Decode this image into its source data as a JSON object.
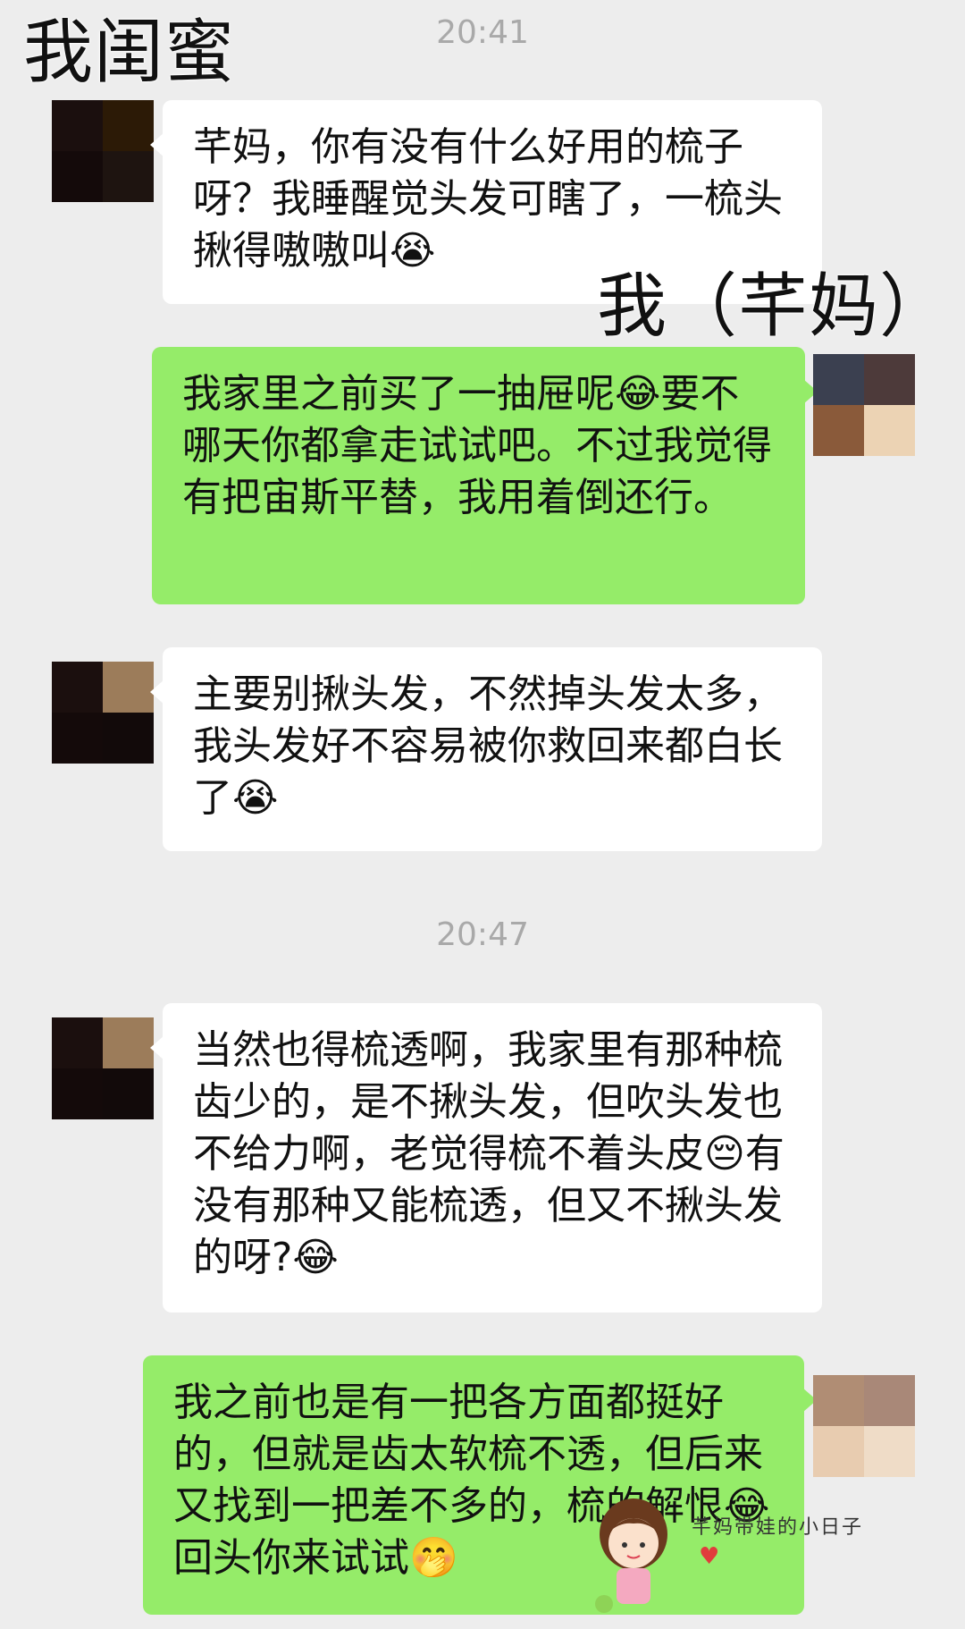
{
  "labels": {
    "friend": "我闺蜜",
    "me": "我（芊妈）"
  },
  "timestamps": [
    "20:41",
    "20:47"
  ],
  "messages": [
    {
      "side": "in",
      "text": "芊妈，你有没有什么好用的梳子呀？我睡醒觉头发可瞎了，一梳头揪得嗷嗷叫😭"
    },
    {
      "side": "out",
      "text": "我家里之前买了一抽屉呢😂要不哪天你都拿走试试吧。不过我觉得有把宙斯平替，我用着倒还行。"
    },
    {
      "side": "in",
      "text": "主要别揪头发，不然掉头发太多，我头发好不容易被你救回来都白长了😭"
    },
    {
      "side": "in",
      "text": "当然也得梳透啊，我家里有那种梳齿少的，是不揪头发，但吹头发也不给力啊，老觉得梳不着头皮😔有没有那种又能梳透，但又不揪头发的呀?😂"
    },
    {
      "side": "out",
      "text": "我之前也是有一把各方面都挺好的，但就是齿太软梳不透，但后来又找到一把差不多的，梳的解恨😂回头你来试试🤭"
    }
  ],
  "watermark": {
    "text": "芊妈带娃的小日子"
  },
  "colors": {
    "background": "#ededed",
    "incoming_bubble": "#ffffff",
    "outgoing_bubble": "#95ec69",
    "timestamp": "#a9a9a9"
  }
}
